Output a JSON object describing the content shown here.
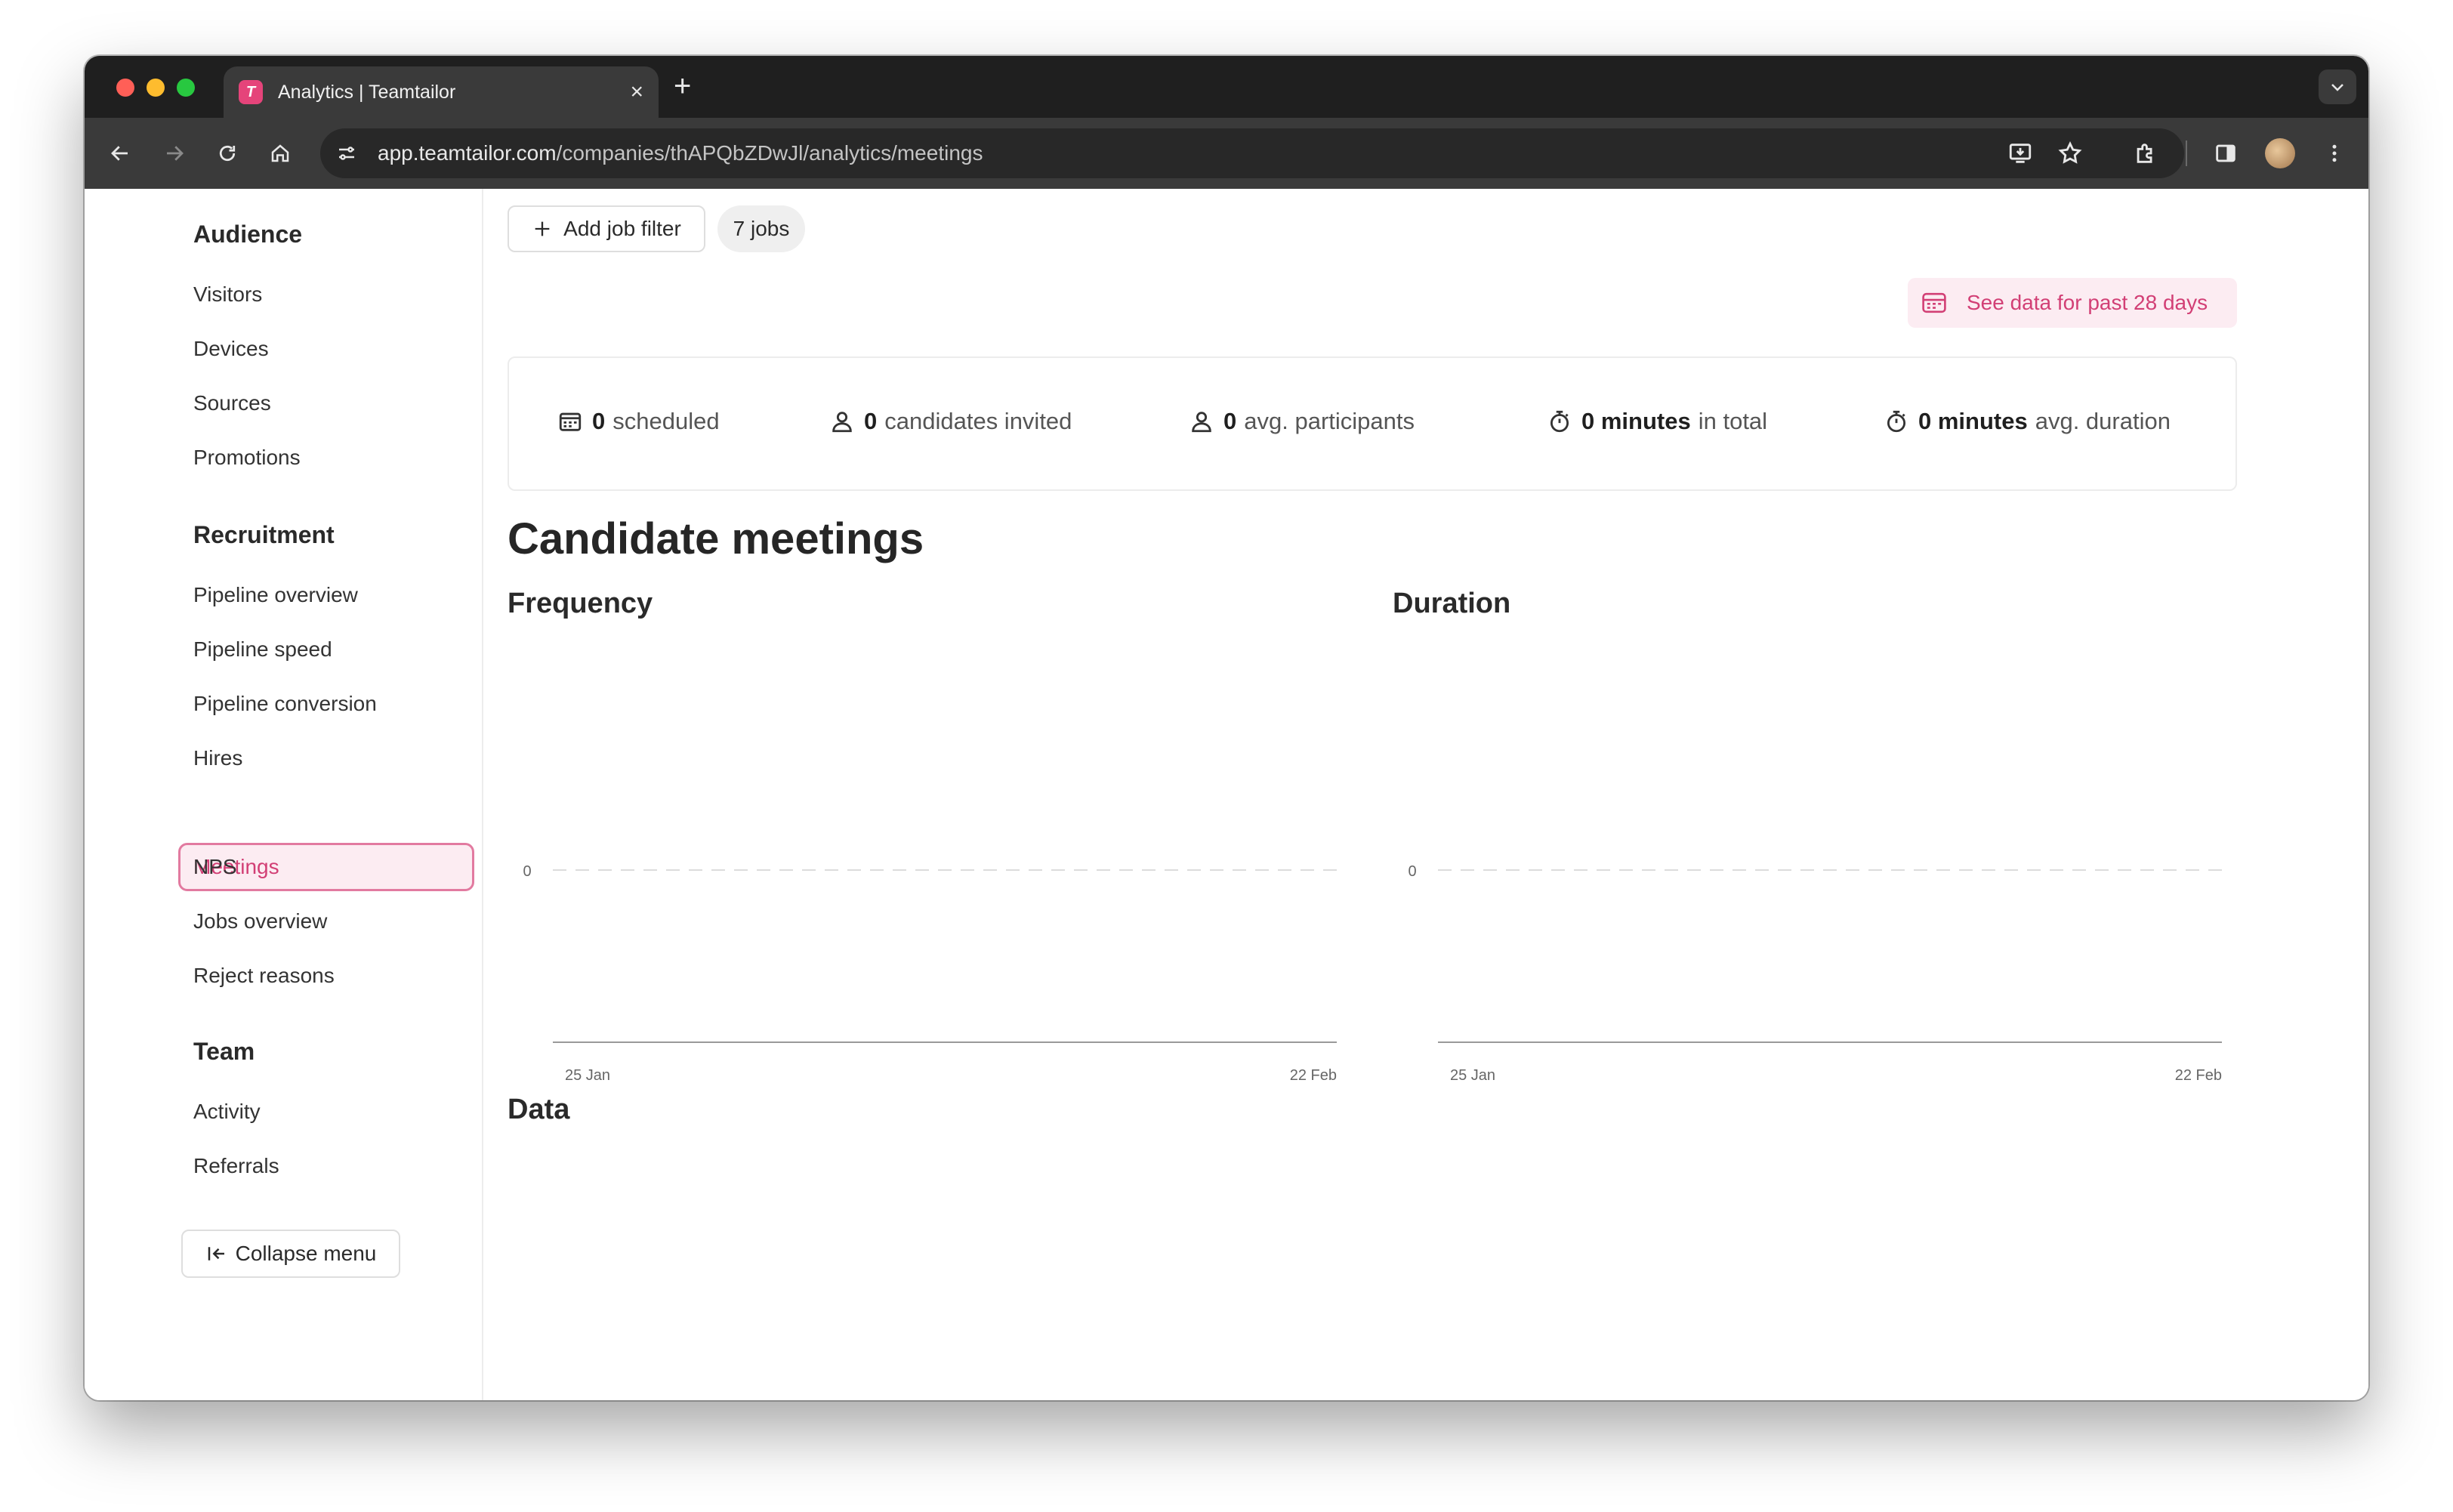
{
  "browser": {
    "tab_title": "Analytics | Teamtailor",
    "favicon_letter": "T",
    "url_host": "app.teamtailor.com",
    "url_path": "/companies/thAPQbZDwJl/analytics/meetings"
  },
  "sidebar": {
    "sections": [
      {
        "title": "Audience",
        "items": [
          "Visitors",
          "Devices",
          "Sources",
          "Promotions"
        ]
      },
      {
        "title": "Recruitment",
        "items": [
          "Pipeline overview",
          "Pipeline speed",
          "Pipeline conversion",
          "Hires",
          "Meetings",
          "NPS",
          "Jobs overview",
          "Reject reasons"
        ]
      },
      {
        "title": "Team",
        "items": [
          "Activity",
          "Referrals"
        ]
      }
    ],
    "active_item": "Meetings",
    "collapse_label": "Collapse menu"
  },
  "toolbar": {
    "add_filter_label": "Add job filter",
    "jobs_pill": "7 jobs",
    "date_range_label": "See data for past 28 days"
  },
  "stats": {
    "scheduled": {
      "value": "0",
      "label": "scheduled"
    },
    "candidates_invited": {
      "value": "0",
      "label": "candidates invited"
    },
    "avg_participants": {
      "value": "0",
      "label": "avg. participants"
    },
    "total_minutes": {
      "value": "0 minutes",
      "label": "in total"
    },
    "avg_duration": {
      "value": "0 minutes",
      "label": "avg. duration"
    }
  },
  "main": {
    "title": "Candidate meetings",
    "data_title": "Data"
  },
  "colors": {
    "accent": "#d23f75",
    "accent_bg": "#fcecf2"
  },
  "chart_data": [
    {
      "type": "line",
      "title": "Frequency",
      "x_tick_labels": [
        "25 Jan",
        "22 Feb"
      ],
      "y_tick_labels": [
        "0"
      ],
      "series": [],
      "grid": true
    },
    {
      "type": "line",
      "title": "Duration",
      "x_tick_labels": [
        "25 Jan",
        "22 Feb"
      ],
      "y_tick_labels": [
        "0"
      ],
      "series": [],
      "grid": true
    }
  ]
}
